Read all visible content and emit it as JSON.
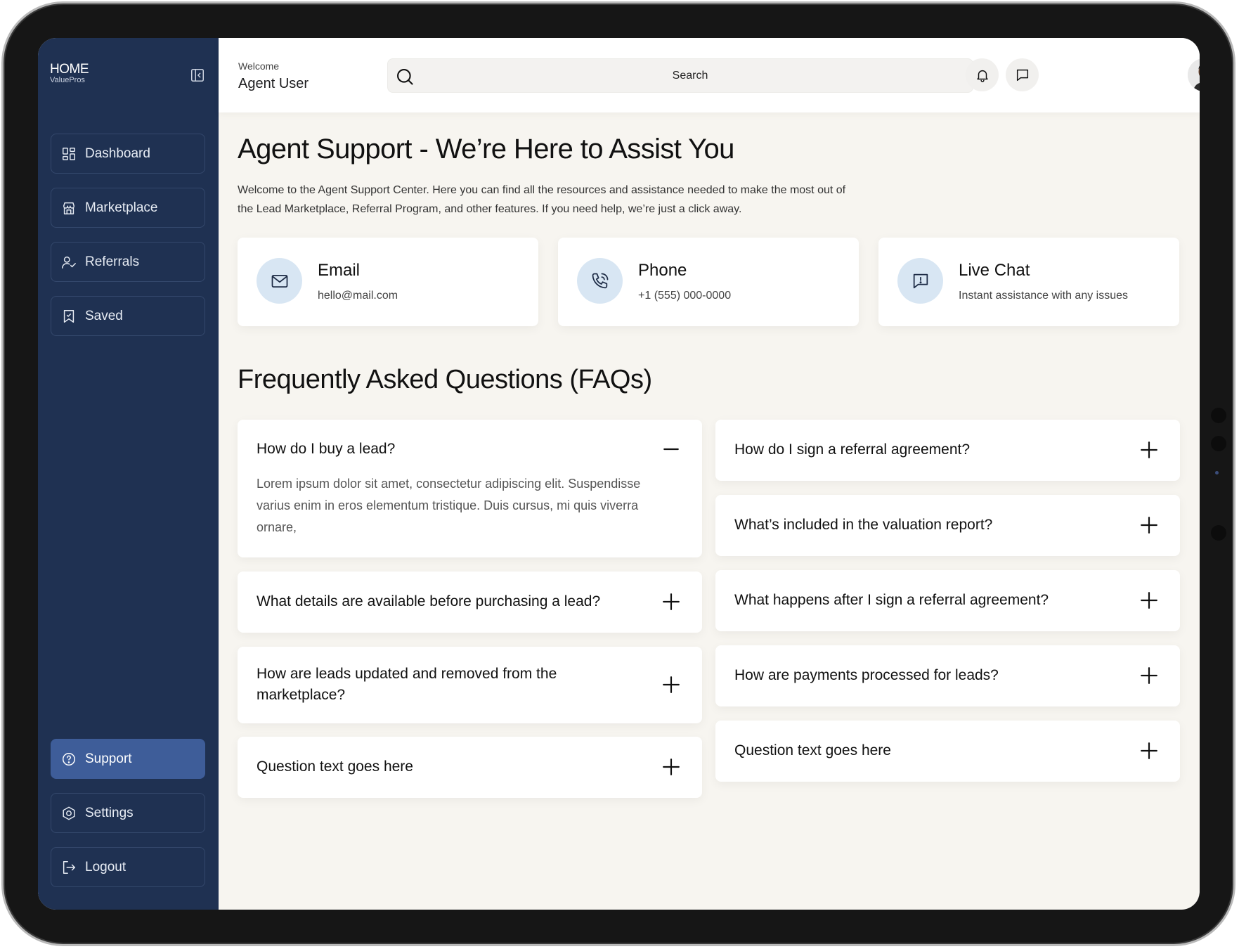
{
  "app": {
    "logo_main": "HOME",
    "logo_sub": "ValuePros"
  },
  "sidebar": {
    "items": [
      {
        "label": "Dashboard",
        "icon": "dashboard-icon"
      },
      {
        "label": "Marketplace",
        "icon": "store-icon"
      },
      {
        "label": "Referrals",
        "icon": "user-check-icon"
      },
      {
        "label": "Saved",
        "icon": "bookmark-icon"
      },
      {
        "label": "Support",
        "icon": "help-circle-icon",
        "active": true
      },
      {
        "label": "Settings",
        "icon": "settings-icon"
      },
      {
        "label": "Logout",
        "icon": "logout-icon"
      }
    ]
  },
  "header": {
    "welcome": "Welcome",
    "user_name": "Agent User",
    "search_placeholder": "Search"
  },
  "main": {
    "title": "Agent Support - We’re Here to Assist You",
    "description": "Welcome to the Agent Support Center. Here you can find all the resources and assistance needed to make the most out of the Lead Marketplace, Referral Program, and other features. If you need help, we’re just a click away.",
    "contacts": [
      {
        "title": "Email",
        "subtitle": "hello@mail.com",
        "icon": "mail-icon"
      },
      {
        "title": "Phone",
        "subtitle": "+1 (555) 000-0000",
        "icon": "phone-icon"
      },
      {
        "title": "Live Chat",
        "subtitle": "Instant assistance with any issues",
        "icon": "chat-alert-icon"
      }
    ],
    "faq_title": "Frequently Asked Questions (FAQs)",
    "faqs_left": [
      {
        "question": "How do I buy a lead?",
        "answer": "Lorem ipsum dolor sit amet, consectetur adipiscing elit. Suspendisse varius enim in eros elementum tristique. Duis cursus, mi quis viverra ornare,",
        "expanded": true
      },
      {
        "question": "What details are available before purchasing a lead?"
      },
      {
        "question": "How are leads updated and removed from the marketplace?"
      },
      {
        "question": "Question text goes here"
      }
    ],
    "faqs_right": [
      {
        "question": "How do I sign a referral agreement?"
      },
      {
        "question": "What’s included in the valuation report?"
      },
      {
        "question": "What happens after I sign a referral agreement?"
      },
      {
        "question": "How are payments processed for leads?"
      },
      {
        "question": "Question text goes here"
      }
    ]
  },
  "colors": {
    "sidebar": "#1f3152",
    "active": "#3e5d99",
    "background": "#f7f5f0",
    "contact_icon_bg": "#d8e6f3"
  }
}
